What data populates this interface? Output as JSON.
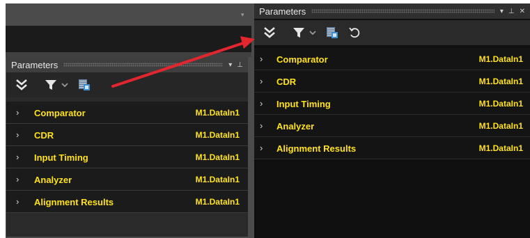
{
  "left_panel": {
    "title": "Parameters",
    "controls": [
      "▾",
      "⊥"
    ],
    "toolbar_icons": [
      "expand-all-icon",
      "filter-icon",
      "grid-settings-icon"
    ],
    "parameters": [
      {
        "name": "Comparator",
        "value": "M1.DataIn1"
      },
      {
        "name": "CDR",
        "value": "M1.DataIn1"
      },
      {
        "name": "Input Timing",
        "value": "M1.DataIn1"
      },
      {
        "name": "Analyzer",
        "value": "M1.DataIn1"
      },
      {
        "name": "Alignment Results",
        "value": "M1.DataIn1"
      }
    ]
  },
  "right_panel": {
    "title": "Parameters",
    "controls": [
      "▾",
      "⊥",
      "✕"
    ],
    "toolbar_icons": [
      "expand-all-icon",
      "filter-icon",
      "grid-settings-icon",
      "reset-icon"
    ],
    "parameters": [
      {
        "name": "Comparator",
        "value": "M1.DataIn1"
      },
      {
        "name": "CDR",
        "value": "M1.DataIn1"
      },
      {
        "name": "Input Timing",
        "value": "M1.DataIn1"
      },
      {
        "name": "Analyzer",
        "value": "M1.DataIn1"
      },
      {
        "name": "Alignment Results",
        "value": "M1.DataIn1"
      }
    ]
  },
  "colors": {
    "value_text": "#ffe21a",
    "annotation_arrow": "#e3262d",
    "panel_dark": "#1b1b1b"
  }
}
